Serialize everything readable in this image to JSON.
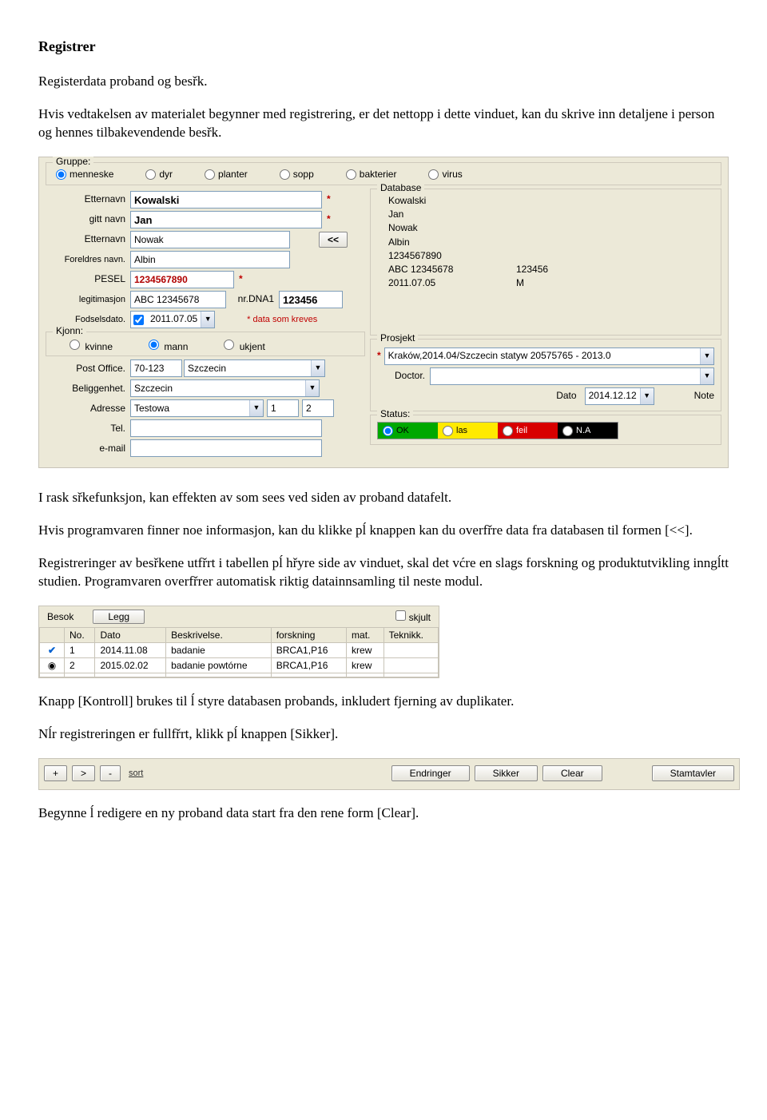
{
  "title": "Registrer",
  "intro1": "Registerdata proband og besřk.",
  "intro2": "Hvis vedtakelsen av materialet begynner med registrering, er det nettopp i dette vinduet, kan du skrive inn detaljene i person og hennes tilbakevendende besřk.",
  "group": {
    "legend": "Gruppe:",
    "options": [
      "menneske",
      "dyr",
      "planter",
      "sopp",
      "bakterier",
      "virus"
    ],
    "selected": "menneske"
  },
  "left": {
    "labels": {
      "etternavn": "Etternavn",
      "gitt_navn": "gitt navn",
      "etternavn2": "Etternavn",
      "foreldre": "Foreldres navn.",
      "pesel": "PESEL",
      "legitimasjon": "legitimasjon",
      "nrdna": "nr.DNA1",
      "fodselsdato": "Fodselsdato.",
      "kjonn_legend": "Kjonn:",
      "kjonn": [
        "kvinne",
        "mann",
        "ukjent"
      ],
      "post": "Post Office.",
      "beliggenhet": "Beliggenhet.",
      "adresse": "Adresse",
      "tel": "Tel.",
      "email": "e-mail"
    },
    "values": {
      "etternavn": "Kowalski",
      "gitt_navn": "Jan",
      "etternavn2": "Nowak",
      "foreldre": "Albin",
      "pesel": "1234567890",
      "legitimasjon": "ABC 12345678",
      "nrdna": "123456",
      "fodselsdato": "2011.07.05",
      "data_som_kreves": "* data som kreves",
      "kjonn_selected": "mann",
      "post_zip": "70-123",
      "post_city": "Szczecin",
      "beliggenhet": "Szczecin",
      "adresse": "Testowa",
      "adresse_n1": "1",
      "adresse_n2": "2"
    },
    "copy_btn": "<<"
  },
  "right": {
    "database_legend": "Database",
    "db_rows": [
      [
        "Kowalski",
        ""
      ],
      [
        "Jan",
        ""
      ],
      [
        "Nowak",
        ""
      ],
      [
        "Albin",
        ""
      ],
      [
        "1234567890",
        ""
      ],
      [
        "ABC 12345678",
        "123456"
      ],
      [
        "2011.07.05",
        "M"
      ]
    ],
    "prosjekt_legend": "Prosjekt",
    "prosjekt": "Kraków,2014.04/Szczecin statyw 20575765 - 2013.0",
    "doctor_label": "Doctor.",
    "dato_label": "Dato",
    "dato_value": "2014.12.12",
    "note_label": "Note",
    "status_legend": "Status:",
    "status": {
      "ok": "OK",
      "las": "las",
      "feil": "feil",
      "na": "N.A"
    }
  },
  "para_after_form_1": "I rask sřkefunksjon, kan effekten av som sees ved siden av proband datafelt.",
  "para_after_form_2": "Hvis programvaren finner noe informasjon, kan du klikke pĺ knappen kan du overfřre data fra databasen til formen [<<].",
  "para_after_form_3": "Registreringer av besřkene utfřrt i tabellen pĺ hřyre side av vinduet, skal det vćre en slags forskning og produktutvikling inngĺtt studien. Programvaren overfřrer automatisk riktig datainnsamling til neste modul.",
  "visits": {
    "besok": "Besok",
    "legg": "Legg",
    "skjult": "skjult",
    "headers": [
      "No.",
      "Dato",
      "Beskrivelse.",
      "forskning",
      "mat.",
      "Teknikk."
    ],
    "rows": [
      {
        "icon": "✔",
        "no": "1",
        "dato": "2014.11.08",
        "beskr": "badanie",
        "forsk": "BRCA1,P16",
        "mat": "krew",
        "tek": ""
      },
      {
        "icon": "◉",
        "no": "2",
        "dato": "2015.02.02",
        "beskr": "badanie powtórne",
        "forsk": "BRCA1,P16",
        "mat": "krew",
        "tek": ""
      }
    ]
  },
  "para_after_visits_1": "Knapp [Kontroll] brukes til ĺ styre databasen probands, inkludert fjerning av duplikater.",
  "para_after_visits_2": "Nĺr registreringen er fullfřrt, klikk pĺ knappen [Sikker].",
  "toolbar": {
    "plus": "+",
    "next": ">",
    "minus": "-",
    "sort": "sort",
    "endringer": "Endringer",
    "sikker": "Sikker",
    "clear": "Clear",
    "stamtavler": "Stamtavler"
  },
  "para_last": "Begynne ĺ redigere en ny proband data start fra den rene form [Clear]."
}
